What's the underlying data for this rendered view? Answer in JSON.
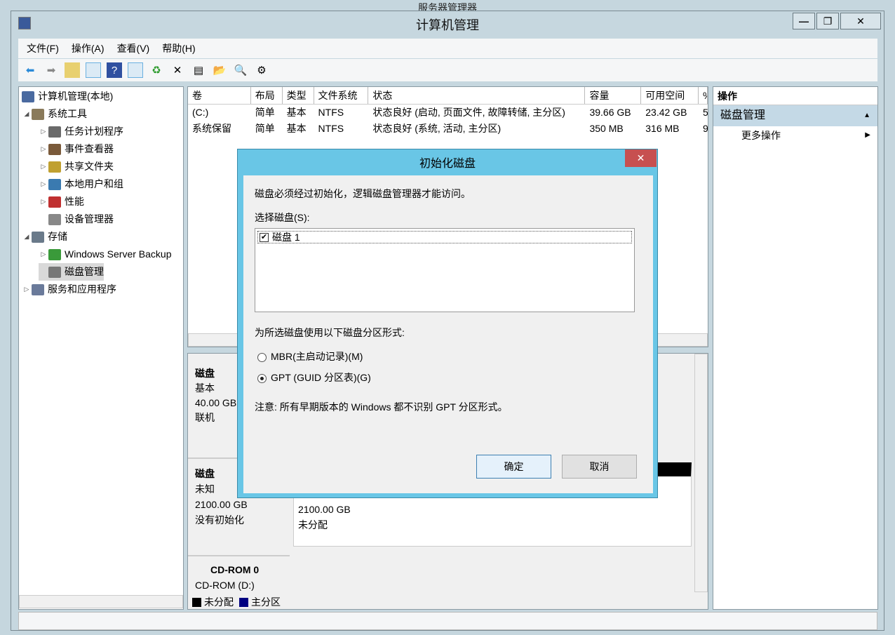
{
  "outer_title": "服务器管理器",
  "window": {
    "title": "计算机管理",
    "buttons": [
      "—",
      "❐",
      "✕"
    ]
  },
  "menu": [
    "文件(F)",
    "操作(A)",
    "查看(V)",
    "帮助(H)"
  ],
  "toolbar": [
    "back-icon",
    "forward-icon",
    "up-icon",
    "show-hide-tree-icon",
    "help-icon",
    "show-action-pane-icon",
    "refresh-icon",
    "delete-icon",
    "properties-icon",
    "open-icon",
    "search-icon",
    "settings-icon"
  ],
  "tree": {
    "root": "计算机管理(本地)",
    "items": [
      {
        "label": "系统工具",
        "level": 1,
        "exp": "◢"
      },
      {
        "label": "任务计划程序",
        "level": 2,
        "exp": "▷"
      },
      {
        "label": "事件查看器",
        "level": 2,
        "exp": "▷"
      },
      {
        "label": "共享文件夹",
        "level": 2,
        "exp": "▷"
      },
      {
        "label": "本地用户和组",
        "level": 2,
        "exp": "▷"
      },
      {
        "label": "性能",
        "level": 2,
        "exp": "▷"
      },
      {
        "label": "设备管理器",
        "level": 2,
        "exp": ""
      },
      {
        "label": "存储",
        "level": 1,
        "exp": "◢"
      },
      {
        "label": "Windows Server Backup",
        "level": 2,
        "exp": "▷"
      },
      {
        "label": "磁盘管理",
        "level": 2,
        "exp": "",
        "selected": true
      },
      {
        "label": "服务和应用程序",
        "level": 1,
        "exp": "▷"
      }
    ]
  },
  "volumes": {
    "columns": [
      "卷",
      "布局",
      "类型",
      "文件系统",
      "状态",
      "容量",
      "可用空间",
      "%"
    ],
    "rows": [
      [
        "(C:)",
        "简单",
        "基本",
        "NTFS",
        "状态良好 (启动, 页面文件, 故障转储, 主分区)",
        "39.66 GB",
        "23.42 GB",
        "5"
      ],
      [
        "系统保留",
        "简单",
        "基本",
        "NTFS",
        "状态良好 (系统, 活动, 主分区)",
        "350 MB",
        "316 MB",
        "9"
      ]
    ]
  },
  "disks": [
    {
      "name": "磁盘",
      "type": "基本",
      "size": "40.00 GB",
      "status": "联机"
    },
    {
      "name": "磁盘",
      "type": "未知",
      "size": "2100.00 GB",
      "status": "没有初始化",
      "part_size": "2100.00 GB",
      "part_status": "未分配"
    },
    {
      "name": "CD-ROM 0",
      "type": "CD-ROM (D:)"
    }
  ],
  "legend": [
    {
      "label": "未分配",
      "color": "#000000"
    },
    {
      "label": "主分区",
      "color": "#000080"
    }
  ],
  "actions": {
    "header": "操作",
    "section": "磁盘管理",
    "more": "更多操作"
  },
  "dialog": {
    "title": "初始化磁盘",
    "message": "磁盘必须经过初始化，逻辑磁盘管理器才能访问。",
    "select_label": "选择磁盘(S):",
    "disk_item": "磁盘 1",
    "disk_checked": true,
    "style_label": "为所选磁盘使用以下磁盘分区形式:",
    "options": [
      "MBR(主启动记录)(M)",
      "GPT (GUID 分区表)(G)"
    ],
    "selected_option": 1,
    "note": "注意: 所有早期版本的 Windows 都不识别 GPT 分区形式。",
    "ok": "确定",
    "cancel": "取消"
  },
  "colors": {
    "dialog_title": "#69c6e6",
    "close": "#c75050"
  }
}
